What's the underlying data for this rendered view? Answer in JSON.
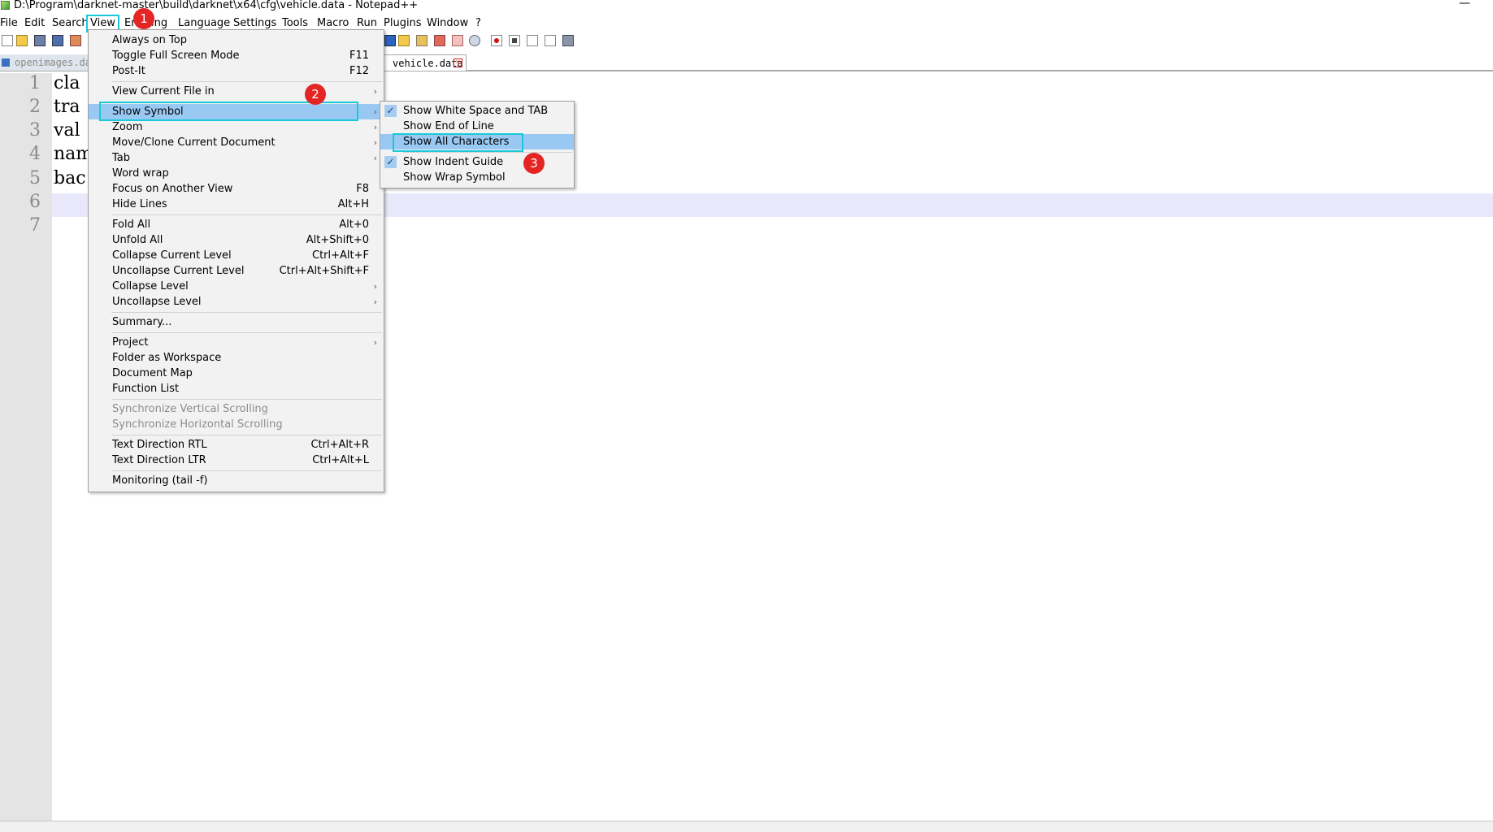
{
  "window": {
    "title": "D:\\Program\\darknet-master\\build\\darknet\\x64\\cfg\\vehicle.data - Notepad++",
    "minimize": "—"
  },
  "menubar": {
    "file": "File",
    "edit": "Edit",
    "search": "Search",
    "view": "View",
    "encoding_partial": "En",
    "encoding_tail": "ing",
    "language": "Language",
    "settings": "Settings",
    "tools": "Tools",
    "macro": "Macro",
    "run": "Run",
    "plugins": "Plugins",
    "window": "Window",
    "help": "?"
  },
  "tabs": {
    "inactive": "openimages.data",
    "active": "vehicle.data",
    "close": "×"
  },
  "editor": {
    "line_numbers": [
      "1",
      "2",
      "3",
      "4",
      "5",
      "6",
      "7"
    ],
    "lines": [
      "cla",
      "tra",
      "val",
      "nam",
      "bac"
    ]
  },
  "view_menu": {
    "always_on_top": "Always on Top",
    "toggle_full_screen": "Toggle Full Screen Mode",
    "toggle_full_screen_key": "F11",
    "post_it": "Post-It",
    "post_it_key": "F12",
    "view_current_file_in": "View Current File in",
    "show_symbol": "Show Symbol",
    "zoom": "Zoom",
    "move_clone": "Move/Clone Current Document",
    "tab": "Tab",
    "word_wrap": "Word wrap",
    "focus_other_view": "Focus on Another View",
    "focus_other_view_key": "F8",
    "hide_lines": "Hide Lines",
    "hide_lines_key": "Alt+H",
    "fold_all": "Fold All",
    "fold_all_key": "Alt+0",
    "unfold_all": "Unfold All",
    "unfold_all_key": "Alt+Shift+0",
    "collapse_current": "Collapse Current Level",
    "collapse_current_key": "Ctrl+Alt+F",
    "uncollapse_current": "Uncollapse Current Level",
    "uncollapse_current_key": "Ctrl+Alt+Shift+F",
    "collapse_level": "Collapse Level",
    "uncollapse_level": "Uncollapse Level",
    "summary": "Summary...",
    "project": "Project",
    "folder_workspace": "Folder as Workspace",
    "document_map": "Document Map",
    "function_list": "Function List",
    "sync_vertical": "Synchronize Vertical Scrolling",
    "sync_horizontal": "Synchronize Horizontal Scrolling",
    "rtl": "Text Direction RTL",
    "rtl_key": "Ctrl+Alt+R",
    "ltr": "Text Direction LTR",
    "ltr_key": "Ctrl+Alt+L",
    "monitoring": "Monitoring (tail -f)",
    "arrow": "›"
  },
  "symbol_submenu": {
    "show_white_space": "Show White Space and TAB",
    "show_eol": "Show End of Line",
    "show_all_chars": "Show All Characters",
    "show_indent_guide": "Show Indent Guide",
    "show_wrap_symbol": "Show Wrap Symbol",
    "checkmark": "✓"
  },
  "annotations": {
    "step1": "1",
    "step2": "2",
    "step3": "3"
  },
  "colors": {
    "highlight": "#99c9f3",
    "outline": "#19c9d9",
    "badge": "#e52424"
  }
}
